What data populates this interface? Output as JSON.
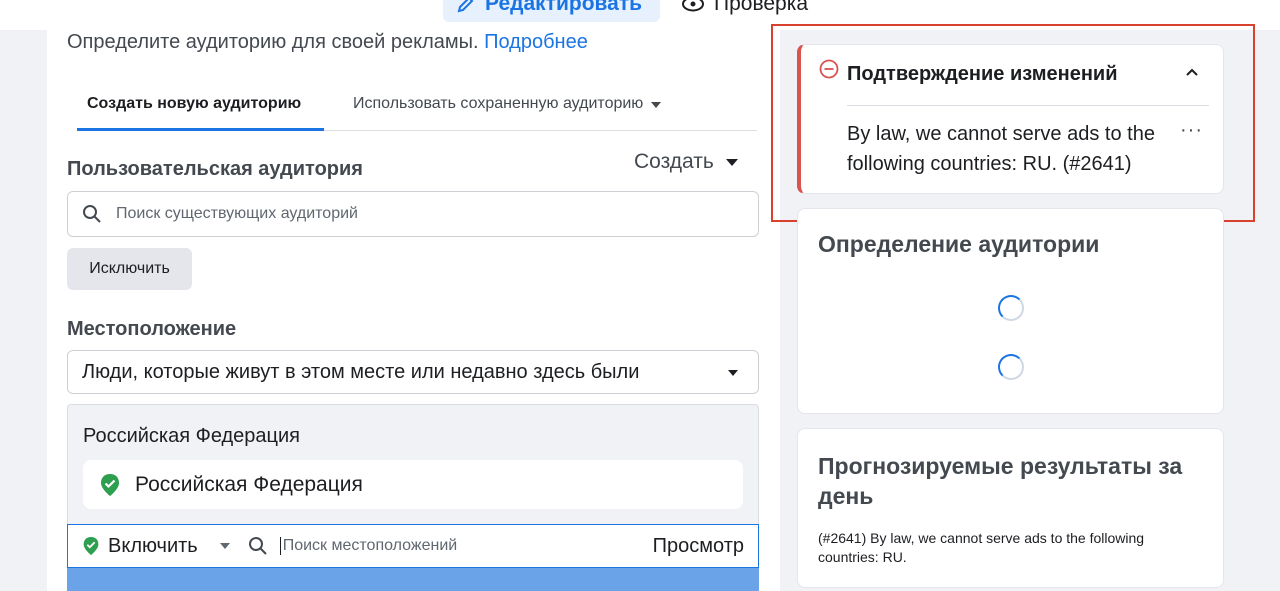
{
  "header": {
    "edit_label": "Редактировать",
    "review_label": "Проверка"
  },
  "left": {
    "intro_text": "Определите аудиторию для своей рекламы.",
    "intro_link": "Подробнее",
    "tabs": [
      {
        "label": "Создать новую аудиторию",
        "active": true
      },
      {
        "label": "Использовать сохраненную аудиторию",
        "active": false
      }
    ],
    "custom_audience": {
      "title": "Пользовательская аудитория",
      "create_label": "Создать",
      "search_placeholder": "Поиск существующих аудиторий",
      "exclude_label": "Исключить"
    },
    "location": {
      "title": "Местоположение",
      "selected_option": "Люди, которые живут в этом месте или недавно здесь были",
      "panel_header": "Российская Федерация",
      "chip_label": "Российская Федерация",
      "include_label": "Включить",
      "search_placeholder": "Поиск местоположений",
      "preview_label": "Просмотр"
    }
  },
  "right": {
    "warning": {
      "title": "Подтверждение изменений",
      "message": "By law, we cannot serve ads to the following countries: RU. (#2641)",
      "more_label": "···"
    },
    "audience_definition": {
      "title": "Определение аудитории"
    },
    "estimated_results": {
      "title": "Прогнозируемые результаты за день",
      "message": "(#2641) By law, we cannot serve ads to the following countries: RU."
    }
  },
  "colors": {
    "accent": "#1b74e4",
    "error": "#d9534f",
    "highlight_border": "#d9412f",
    "success": "#2e9e4f"
  }
}
